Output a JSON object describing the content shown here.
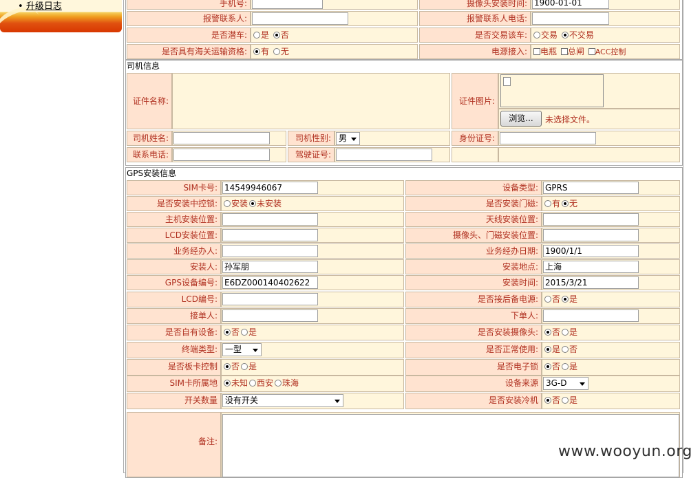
{
  "sidebar": {
    "bullet": "•",
    "link": "升级日志"
  },
  "top": {
    "rows": [
      {
        "l1": "手机号:",
        "v1": "",
        "l2": "摄像头安装时间:",
        "v2": "1900-01-01"
      },
      {
        "l1": "报警联系人:",
        "v1": "",
        "l2": "报警联系人电话:",
        "v2": ""
      },
      {
        "l1": "是否潜车:",
        "opts1": [
          "是",
          "否"
        ],
        "sel1": 1,
        "l2": "是否交易该车:",
        "opts2": [
          "交易",
          "不交易"
        ],
        "sel2": 1
      },
      {
        "l1": "是否具有海关运输资格:",
        "opts1": [
          "有",
          "无"
        ],
        "sel1": 0,
        "l2": "电源接入:",
        "checks2": [
          "电瓶",
          "总闸",
          "ACC控制"
        ]
      }
    ]
  },
  "driver": {
    "title": "司机信息",
    "cert_name_label": "证件名称:",
    "cert_image_label": "证件图片:",
    "browse_button": "浏览...",
    "no_file": "未选择文件。",
    "name_label": "司机姓名:",
    "gender_label": "司机性别:",
    "gender_value": "男",
    "id_label": "身份证号:",
    "phone_label": "联系电话:",
    "license_label": "驾驶证号:"
  },
  "gps": {
    "title": "GPS安装信息",
    "rows": [
      {
        "l1": "SIM卡号:",
        "v1": "14549946067",
        "l2": "设备类型:",
        "v2": "GPRS"
      },
      {
        "l1": "是否安装中控锁:",
        "opts1": [
          "安装",
          "未安装"
        ],
        "sel1": 1,
        "l2": "是否安装门磁:",
        "opts2": [
          "有",
          "无"
        ],
        "sel2": 1
      },
      {
        "l1": "主机安装位置:",
        "v1": "",
        "l2": "天线安装位置:",
        "v2": ""
      },
      {
        "l1": "LCD安装位置:",
        "v1": "",
        "l2": "摄像头、门磁安装位置:",
        "v2": ""
      },
      {
        "l1": "业务经办人:",
        "v1": "",
        "l2": "业务经办日期:",
        "v2": "1900/1/1"
      },
      {
        "l1": "安装人:",
        "v1": "孙军朋",
        "l2": "安装地点:",
        "v2": "上海"
      },
      {
        "l1": "GPS设备编号:",
        "v1": "E6DZ000140402622",
        "l2": "安装时间:",
        "v2": "2015/3/21"
      },
      {
        "l1": "LCD编号:",
        "v1": "",
        "l2": "是否接后备电源:",
        "opts2": [
          "否",
          "是"
        ],
        "sel2": 1
      },
      {
        "l1": "接单人:",
        "v1": "",
        "l2": "下单人:",
        "v2": ""
      },
      {
        "l1": "是否自有设备:",
        "opts1": [
          "否",
          "是"
        ],
        "sel1": 0,
        "l2": "是否安装摄像头:",
        "opts2": [
          "否",
          "是"
        ],
        "sel2": 0
      },
      {
        "l1": "终端类型:",
        "sel_value1": "一型",
        "l2": "是否正常使用:",
        "opts2": [
          "是",
          "否"
        ],
        "sel2": 0
      },
      {
        "l1": "是否板卡控制",
        "opts1": [
          "否",
          "是"
        ],
        "sel1": 0,
        "l2": "是否电子锁",
        "opts2": [
          "否",
          "是"
        ],
        "sel2": 0
      },
      {
        "l1": "SIM卡所属地",
        "opts1": [
          "未知",
          "西安",
          "珠海"
        ],
        "sel1": 0,
        "l2": "设备来源",
        "sel_value2": "3G-D"
      },
      {
        "l1": "开关数量",
        "sel_value1": "没有开关",
        "l2": "是否安装冷机",
        "opts2": [
          "否",
          "是"
        ],
        "sel2": 0
      }
    ],
    "remark_label": "备注:"
  },
  "watermark": "www.wooyun.org"
}
